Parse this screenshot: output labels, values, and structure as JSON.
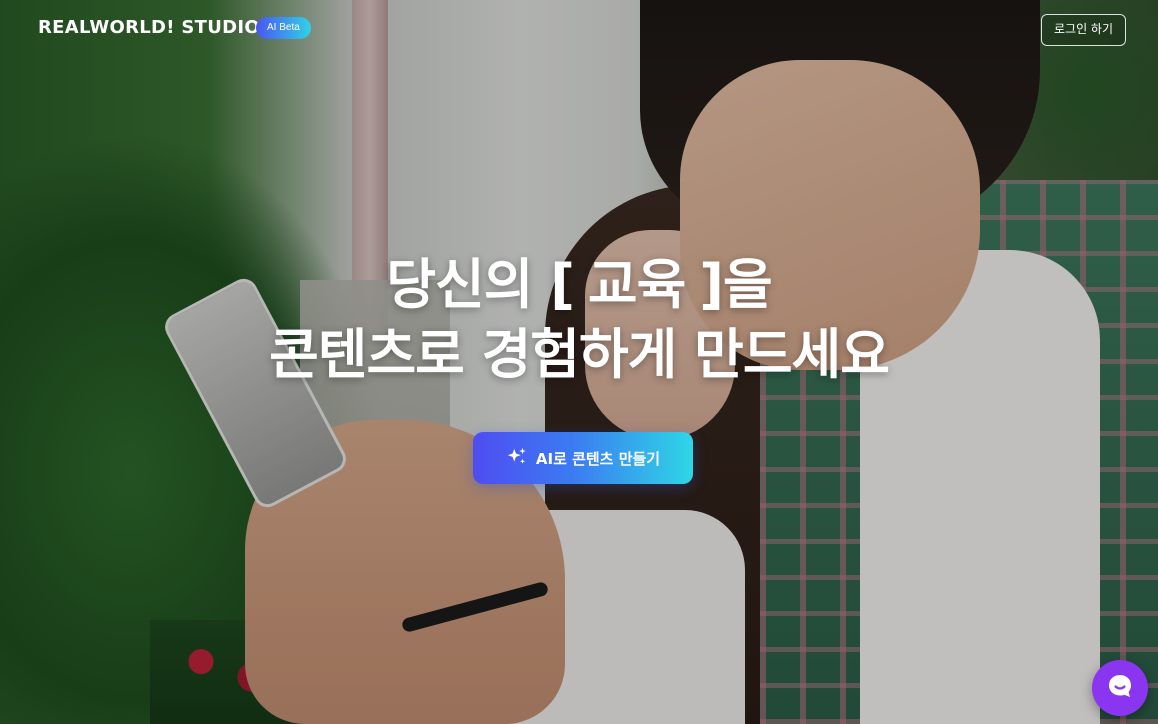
{
  "header": {
    "logo_text": "REALWORLD! STUDIO",
    "beta_badge": "AI Beta",
    "login_label": "로그인 하기"
  },
  "hero": {
    "line1_prefix": "당신의 [",
    "keyword": "교육",
    "line1_suffix": "]을",
    "line2": "콘텐츠로 경험하게 만드세요",
    "cta_label": "AI로 콘텐츠 만들기",
    "cta_icon": "sparkle-icon"
  },
  "chat_widget": {
    "icon": "chat-bubble-icon"
  },
  "colors": {
    "cta_gradient_start": "#4f4cf1",
    "cta_gradient_end": "#2fd6e6",
    "chat_fab": "#8a35f0",
    "badge_start": "#4a55f0",
    "badge_end": "#2fd3e8"
  }
}
